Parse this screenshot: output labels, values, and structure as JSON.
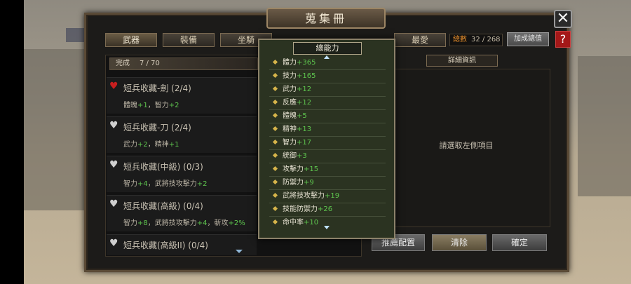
{
  "window": {
    "title": "蒐集冊",
    "close_icon": "close-icon",
    "help_label": "?"
  },
  "tabs": [
    {
      "label": "武器",
      "active": true
    },
    {
      "label": "裝備",
      "active": false
    },
    {
      "label": "坐騎",
      "active": false
    },
    {
      "label": "最愛",
      "active": false
    }
  ],
  "total": {
    "label": "總數",
    "value": "32 / 268"
  },
  "bonus_button": "加成總值",
  "progress": {
    "label": "完成",
    "value": "7 / 70"
  },
  "entries": [
    {
      "name": "短兵收藏-劍 (2/4)",
      "heart": "red",
      "bonus": [
        {
          "t": "體魄",
          "v": "+1"
        },
        {
          "t": "，智力",
          "v": "+2"
        }
      ]
    },
    {
      "name": "短兵收藏-刀 (2/4)",
      "heart": "white",
      "bonus": [
        {
          "t": "武力",
          "v": "+2"
        },
        {
          "t": "，精神",
          "v": "+1"
        }
      ]
    },
    {
      "name": "短兵收藏(中級) (0/3)",
      "heart": "white",
      "bonus": [
        {
          "t": "智力",
          "v": "+4"
        },
        {
          "t": "，武將技攻擊力",
          "v": "+2"
        }
      ]
    },
    {
      "name": "短兵收藏(高級) (0/4)",
      "heart": "white",
      "bonus": [
        {
          "t": "智力",
          "v": "+8"
        },
        {
          "t": "，武將技攻擊力",
          "v": "+4"
        },
        {
          "t": "，斬攻",
          "v": "+2%"
        }
      ]
    },
    {
      "name": "短兵收藏(高級II) (0/4)",
      "heart": "white",
      "bonus": []
    }
  ],
  "detail": {
    "header": "詳細資訊",
    "placeholder": "請選取左側項目"
  },
  "buttons": {
    "recommend": "推薦配置",
    "clear": "清除",
    "confirm": "確定"
  },
  "popup": {
    "title": "總能力",
    "stats": [
      {
        "name": "體力",
        "value": "+365"
      },
      {
        "name": "技力",
        "value": "+165"
      },
      {
        "name": "武力",
        "value": "+12"
      },
      {
        "name": "反應",
        "value": "+12"
      },
      {
        "name": "體魄",
        "value": "+5"
      },
      {
        "name": "精神",
        "value": "+13"
      },
      {
        "name": "智力",
        "value": "+17"
      },
      {
        "name": "統御",
        "value": "+3"
      },
      {
        "name": "攻擊力",
        "value": "+15"
      },
      {
        "name": "防禦力",
        "value": "+9"
      },
      {
        "name": "武將技攻擊力",
        "value": "+19"
      },
      {
        "name": "技能防禦力",
        "value": "+26"
      },
      {
        "name": "命中率",
        "value": "+10"
      }
    ]
  },
  "colors": {
    "accent": "#e08a2a",
    "bonus_green": "#5ec54e",
    "heart_red": "#c81f1f"
  }
}
